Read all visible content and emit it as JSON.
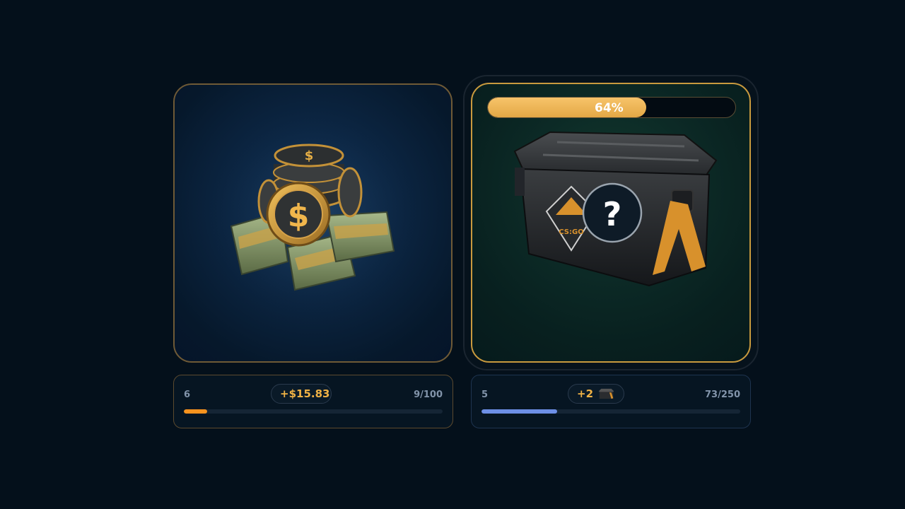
{
  "cash_card": {
    "icon": "money-stack-icon"
  },
  "case_card": {
    "icon": "mystery-case-icon",
    "progress": 0.64,
    "progress_label": "64%",
    "mystery_symbol": "?",
    "case_emblem": "CS:GO"
  },
  "cash_bottom": {
    "level": "6",
    "reward": "+$15.83",
    "count": "9/100",
    "progress": 0.09,
    "bar_color": "#f7931e"
  },
  "case_bottom": {
    "level": "5",
    "reward": "+2",
    "reward_icon": "case-icon",
    "count": "73/250",
    "progress": 0.292,
    "bar_color": "#6d8fe6"
  },
  "colors": {
    "accent_gold": "#e3a745",
    "background": "#04101b"
  }
}
